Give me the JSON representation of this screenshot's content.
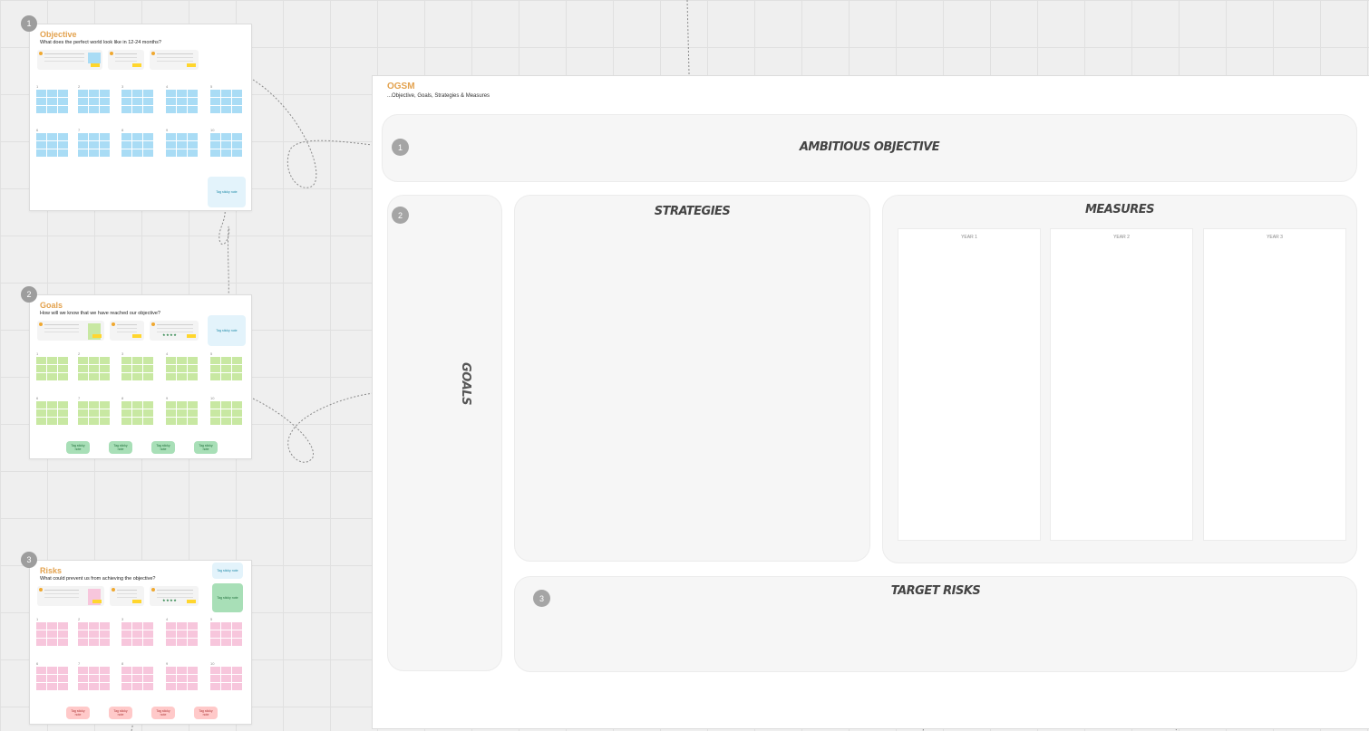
{
  "frames": [
    {
      "number": "1",
      "title": "Objective",
      "subtitle": "What does the perfect world look like in 12-24 months?",
      "columns": [
        "1",
        "2",
        "3",
        "4",
        "5",
        "6",
        "7",
        "8",
        "9",
        "10"
      ],
      "helpers": [
        "Tag sticky note"
      ]
    },
    {
      "number": "2",
      "title": "Goals",
      "subtitle": "How will we know that we have reached our objective?",
      "columns": [
        "1",
        "2",
        "3",
        "4",
        "5",
        "6",
        "7",
        "8",
        "9",
        "10"
      ],
      "helpers": [
        "Tag sticky note",
        "Tag sticky note",
        "Tag sticky note",
        "Tag sticky note",
        "Tag sticky note"
      ]
    },
    {
      "number": "3",
      "title": "Risks",
      "subtitle": "What could prevent us from achieving the objective?",
      "columns": [
        "1",
        "2",
        "3",
        "4",
        "5",
        "6",
        "7",
        "8",
        "9",
        "10"
      ],
      "helpers": [
        "Tag sticky note",
        "Tag sticky note",
        "Tag sticky note",
        "Tag sticky note",
        "Tag sticky note",
        "Tag sticky note"
      ]
    }
  ],
  "ogsm": {
    "title": "OGSM",
    "subtitle": "...Objective, Goals, Strategies & Measures",
    "objective_heading": "AMBITIOUS OBJECTIVE",
    "objective_num": "1",
    "goals_heading": "GOALS",
    "goals_num": "2",
    "strategies_heading": "STRATEGIES",
    "measures_heading": "MEASURES",
    "years": [
      "YEAR 1",
      "YEAR 2",
      "YEAR 3"
    ],
    "risks_heading": "TARGET RISKS",
    "risks_num": "3"
  },
  "colors": {
    "accent": "#e3a24e",
    "objective_cells": "#a9dcf5",
    "goals_cells": "#c8e8a2",
    "risks_cells": "#f7c6dc"
  }
}
